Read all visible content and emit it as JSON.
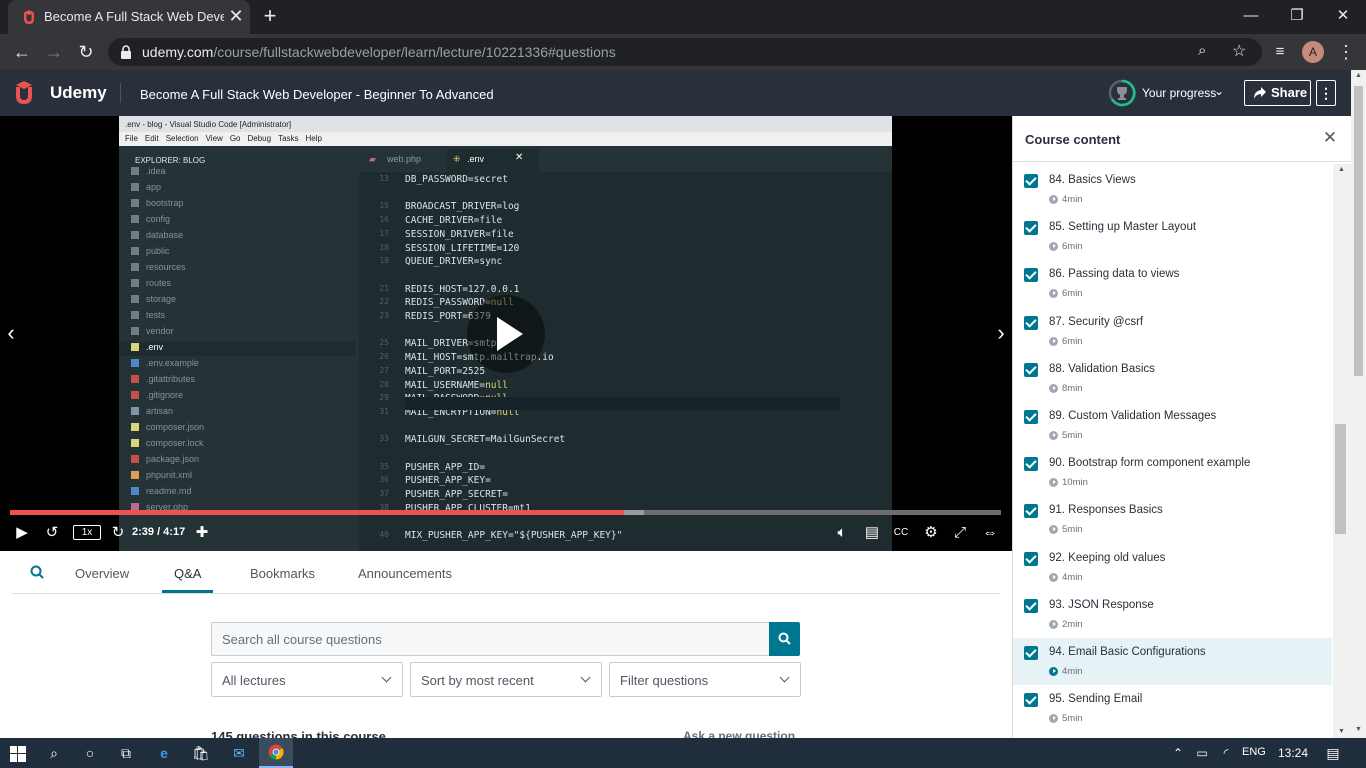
{
  "browser": {
    "tab_title": "Become A Full Stack Web Develo",
    "url_host": "udemy.com",
    "url_path": "/course/fullstackwebdeveloper/learn/lecture/10221336#questions",
    "profile_initial": "A"
  },
  "header": {
    "logo_text": "Udemy",
    "course_title": "Become A Full Stack Web Developer - Beginner To Advanced",
    "progress_label": "Your progress",
    "share_label": "Share",
    "more_label": "⋮"
  },
  "video": {
    "speed": "1x",
    "time_current": "2:39",
    "time_total": "4:17",
    "time_display": "2:39 / 4:17",
    "progress_fraction": 0.62,
    "buffer_fraction": 0.64,
    "vscode": {
      "window_title": ".env - blog - Visual Studio Code [Administrator]",
      "menu": [
        "File",
        "Edit",
        "Selection",
        "View",
        "Go",
        "Debug",
        "Tasks",
        "Help"
      ],
      "explorer_header": "EXPLORER: BLOG",
      "files": [
        ".idea",
        "app",
        "bootstrap",
        "config",
        "database",
        "public",
        "resources",
        "routes",
        "storage",
        "tests",
        "vendor",
        ".env",
        ".env.example",
        ".gitattributes",
        ".gitignore",
        "artisan",
        "composer.json",
        "composer.lock",
        "package.json",
        "phpunit.xml",
        "readme.md",
        "server.php"
      ],
      "tab_inactive": "web.php",
      "tab_active": ".env",
      "code_lines": [
        {
          "num": "13",
          "key": "DB_PASSWORD=",
          "val": "secret"
        },
        {
          "num": "",
          "key": "",
          "val": ""
        },
        {
          "num": "15",
          "key": "BROADCAST_DRIVER=",
          "val": "log"
        },
        {
          "num": "16",
          "key": "CACHE_DRIVER=",
          "val": "file"
        },
        {
          "num": "17",
          "key": "SESSION_DRIVER=",
          "val": "file"
        },
        {
          "num": "18",
          "key": "SESSION_LIFETIME=",
          "val": "120"
        },
        {
          "num": "19",
          "key": "QUEUE_DRIVER=",
          "val": "sync"
        },
        {
          "num": "",
          "key": "",
          "val": ""
        },
        {
          "num": "21",
          "key": "REDIS_HOST=",
          "val": "127.0.0.1"
        },
        {
          "num": "22",
          "key": "REDIS_PASSWORD=",
          "val": "null"
        },
        {
          "num": "23",
          "key": "REDIS_PORT=",
          "val": "6379"
        },
        {
          "num": "",
          "key": "",
          "val": ""
        },
        {
          "num": "25",
          "key": "MAIL_DRIVER=",
          "val": "smtp"
        },
        {
          "num": "26",
          "key": "MAIL_HOST=",
          "val": "smtp.mailtrap.io"
        },
        {
          "num": "27",
          "key": "MAIL_PORT=",
          "val": "2525"
        },
        {
          "num": "28",
          "key": "MAIL_USERNAME=",
          "val": "null"
        },
        {
          "num": "29",
          "key": "MAIL_PASSWORD=",
          "val": "null"
        },
        {
          "num": "31",
          "key": "MAIL_ENCRYPTION=",
          "val": "null"
        },
        {
          "num": "",
          "key": "",
          "val": ""
        },
        {
          "num": "33",
          "key": "MAILGUN_SECRET=",
          "val": "MailGunSecret"
        },
        {
          "num": "",
          "key": "",
          "val": ""
        },
        {
          "num": "35",
          "key": "PUSHER_APP_ID=",
          "val": ""
        },
        {
          "num": "36",
          "key": "PUSHER_APP_KEY=",
          "val": ""
        },
        {
          "num": "37",
          "key": "PUSHER_APP_SECRET=",
          "val": ""
        },
        {
          "num": "38",
          "key": "PUSHER_APP_CLUSTER=",
          "val": "mt1"
        },
        {
          "num": "",
          "key": "",
          "val": ""
        },
        {
          "num": "40",
          "key": "MIX_PUSHER_APP_KEY=",
          "val": "\"${PUSHER_APP_KEY}\""
        }
      ]
    }
  },
  "course_tabs": {
    "overview": "Overview",
    "qa": "Q&A",
    "bookmarks": "Bookmarks",
    "announcements": "Announcements"
  },
  "qa": {
    "search_placeholder": "Search all course questions",
    "filter_lectures": "All lectures",
    "sort": "Sort by most recent",
    "filter_questions": "Filter questions",
    "count_label": "145 questions in this course",
    "ask_label": "Ask a new question"
  },
  "sidebar": {
    "title": "Course content",
    "lectures": [
      {
        "title": "84. Basics Views",
        "duration": "4min",
        "completed": true,
        "active": false
      },
      {
        "title": "85. Setting up Master Layout",
        "duration": "6min",
        "completed": true,
        "active": false
      },
      {
        "title": "86. Passing data to views",
        "duration": "6min",
        "completed": true,
        "active": false
      },
      {
        "title": "87. Security @csrf",
        "duration": "6min",
        "completed": true,
        "active": false
      },
      {
        "title": "88. Validation Basics",
        "duration": "8min",
        "completed": true,
        "active": false
      },
      {
        "title": "89. Custom Validation Messages",
        "duration": "5min",
        "completed": true,
        "active": false
      },
      {
        "title": "90. Bootstrap form component example",
        "duration": "10min",
        "completed": true,
        "active": false
      },
      {
        "title": "91. Responses Basics",
        "duration": "5min",
        "completed": true,
        "active": false
      },
      {
        "title": "92. Keeping old values",
        "duration": "4min",
        "completed": true,
        "active": false
      },
      {
        "title": "93. JSON Response",
        "duration": "2min",
        "completed": true,
        "active": false
      },
      {
        "title": "94. Email Basic Configurations",
        "duration": "4min",
        "completed": true,
        "active": true
      },
      {
        "title": "95. Sending Email",
        "duration": "5min",
        "completed": true,
        "active": false
      }
    ]
  },
  "taskbar": {
    "lang": "ENG",
    "time": "13:24"
  },
  "colors": {
    "udemy_dark": "#29303b",
    "accent": "#007791",
    "udemy_red": "#ec5252"
  }
}
